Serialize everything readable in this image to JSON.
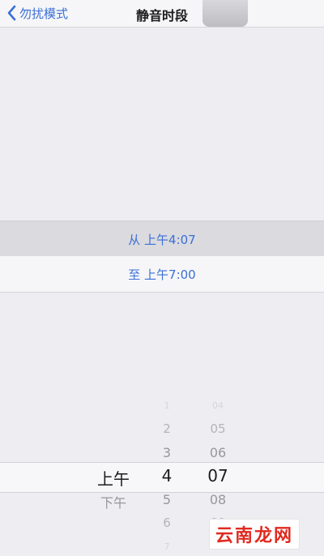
{
  "nav": {
    "back_label": "勿扰模式",
    "title": "静音时段"
  },
  "rows": {
    "from": "从 上午4:07",
    "to": "至 上午7:00"
  },
  "picker": {
    "ampm": [
      {
        "text": "上午",
        "selected": true
      },
      {
        "text": "下午",
        "selected": false
      }
    ],
    "hours": [
      {
        "text": "1"
      },
      {
        "text": "2"
      },
      {
        "text": "3"
      },
      {
        "text": "4",
        "selected": true
      },
      {
        "text": "5"
      },
      {
        "text": "6"
      },
      {
        "text": "7"
      }
    ],
    "minutes": [
      {
        "text": "04"
      },
      {
        "text": "05"
      },
      {
        "text": "06"
      },
      {
        "text": "07",
        "selected": true
      },
      {
        "text": "08"
      },
      {
        "text": "09"
      },
      {
        "text": "10"
      }
    ]
  },
  "watermark": "云南龙网",
  "colors": {
    "accent": "#3b6fd6",
    "watermark": "#e02a1f"
  }
}
